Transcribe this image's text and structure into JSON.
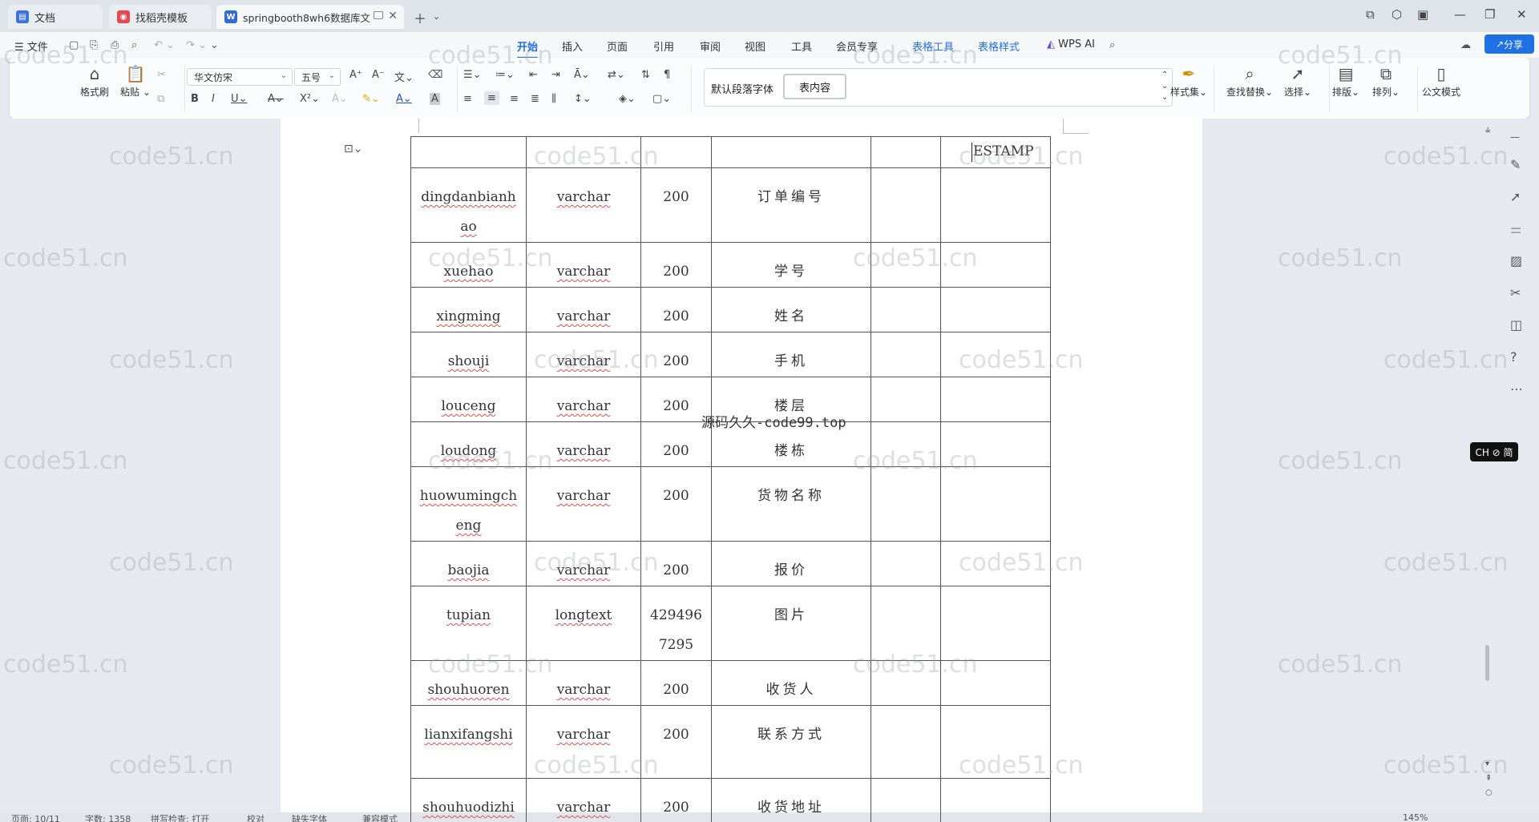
{
  "tabs": [
    {
      "label": "文档",
      "icon": "docs-icon"
    },
    {
      "label": "找稻壳模板",
      "icon": "docer-icon"
    },
    {
      "label": "springbooth8wh6数据库文",
      "icon": "word-icon"
    }
  ],
  "menu": {
    "file": "文件",
    "items": [
      "开始",
      "插入",
      "页面",
      "引用",
      "审阅",
      "视图",
      "工具",
      "会员专享"
    ],
    "table_tools": "表格工具",
    "table_style": "表格样式",
    "wps_ai": "WPS AI",
    "share": "分享"
  },
  "ribbon": {
    "format_painter": "格式刷",
    "paste": "粘贴",
    "font_name": "华文仿宋",
    "font_size": "五号",
    "style_default": "默认段落字体",
    "style_table": "表内容",
    "styles_set": "样式集",
    "find_replace": "查找替换",
    "select": "选择",
    "layout": "排版",
    "arrange": "排列",
    "official_mode": "公文模式"
  },
  "table": {
    "top_row_last": "ESTAMP",
    "rows": [
      {
        "name": "dingdanbianhao",
        "type": "varchar",
        "length": "200",
        "comment": "订单编号"
      },
      {
        "name": "xuehao",
        "type": "varchar",
        "length": "200",
        "comment": "学号"
      },
      {
        "name": "xingming",
        "type": "varchar",
        "length": "200",
        "comment": "姓名"
      },
      {
        "name": "shouji",
        "type": "varchar",
        "length": "200",
        "comment": "手机"
      },
      {
        "name": "louceng",
        "type": "varchar",
        "length": "200",
        "comment": "楼层"
      },
      {
        "name": "loudong",
        "type": "varchar",
        "length": "200",
        "comment": "楼栋"
      },
      {
        "name": "huowumingcheng",
        "type": "varchar",
        "length": "200",
        "comment": "货物名称"
      },
      {
        "name": "baojia",
        "type": "varchar",
        "length": "200",
        "comment": "报价"
      },
      {
        "name": "tupian",
        "type": "longtext",
        "length": "4294967295",
        "comment": "图片"
      },
      {
        "name": "shouhuoren",
        "type": "varchar",
        "length": "200",
        "comment": "收货人"
      },
      {
        "name": "lianxifangshi",
        "type": "varchar",
        "length": "200",
        "comment": "联系方式"
      },
      {
        "name": "shouhuodizhi",
        "type": "varchar",
        "length": "200",
        "comment": "收货地址"
      }
    ]
  },
  "watermark": "code51.cn",
  "center_watermark": "源码久久-code99.top",
  "ime_badge": "CH ⊘ 简",
  "status": {
    "page": "页面: 10/11",
    "words": "字数: 1358",
    "spell": "拼写检查: 打开",
    "proof": "校对",
    "missing_font": "缺失字体",
    "compat": "兼容模式",
    "zoom": "145%"
  }
}
